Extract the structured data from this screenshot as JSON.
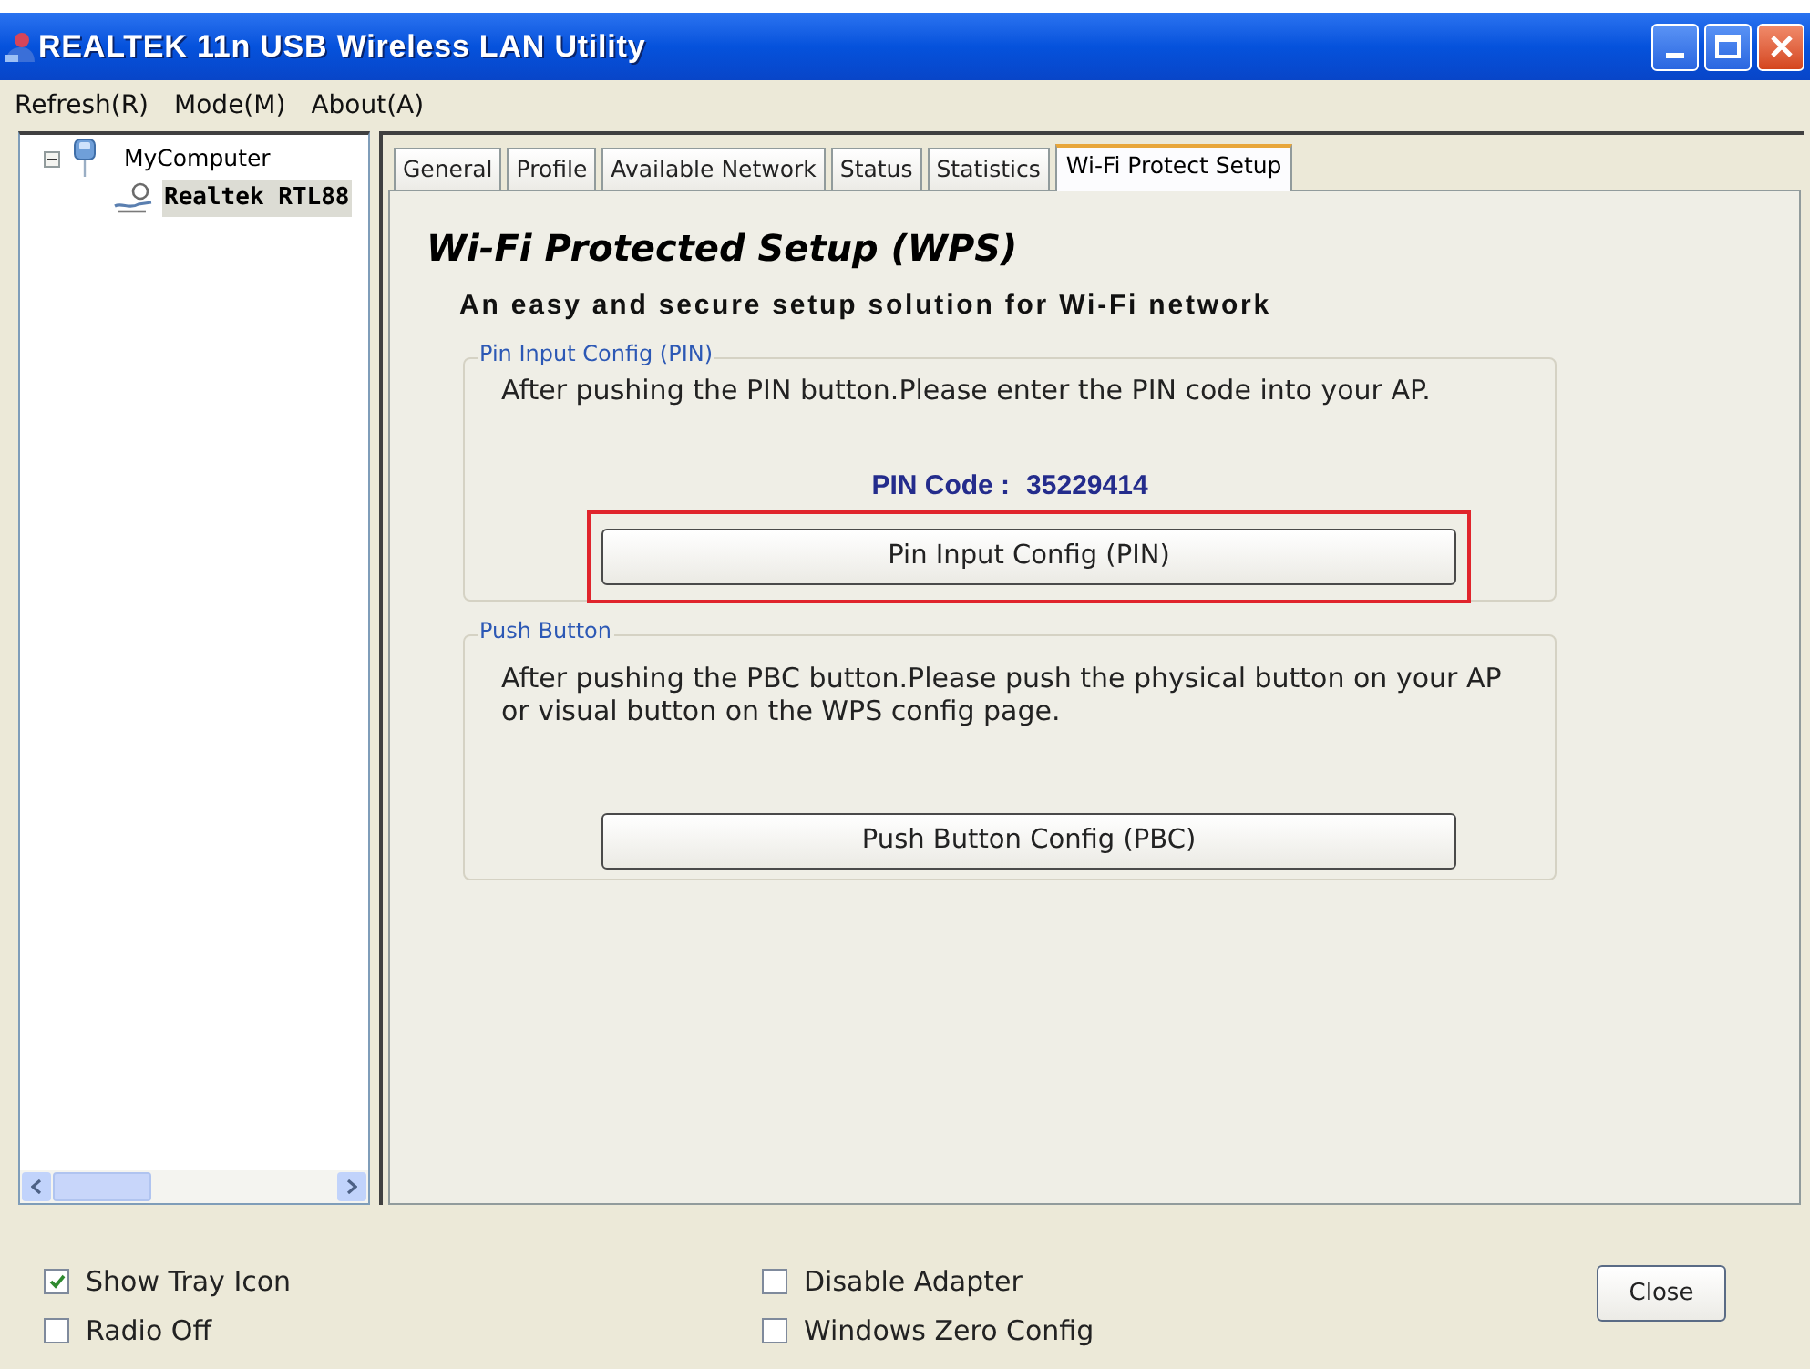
{
  "window": {
    "title": "REALTEK 11n USB Wireless LAN Utility"
  },
  "menu": [
    {
      "label": "Refresh(R)"
    },
    {
      "label": "Mode(M)"
    },
    {
      "label": "About(A)"
    }
  ],
  "tree": [
    {
      "label": "MyComputer",
      "expanded": true,
      "selected": false,
      "children": [
        {
          "label": "Realtek RTL88",
          "selected": true
        }
      ]
    }
  ],
  "tabs": [
    {
      "label": "General",
      "selected": false
    },
    {
      "label": "Profile",
      "selected": false
    },
    {
      "label": "Available Network",
      "selected": false
    },
    {
      "label": "Status",
      "selected": false
    },
    {
      "label": "Statistics",
      "selected": false
    },
    {
      "label": "Wi-Fi Protect Setup",
      "selected": true
    }
  ],
  "panel": {
    "title": "Wi-Fi Protected Setup (WPS)",
    "subtitle": "An easy and secure setup solution for Wi-Fi network",
    "groups": [
      {
        "kind": "pin",
        "legend": "Pin Input Config (PIN)",
        "description": "After pushing the PIN button.Please enter the PIN code into your AP.",
        "pin_label": "PIN Code :",
        "pin_value": "35229414",
        "button": {
          "label": "Pin Input Config (PIN)",
          "highlighted": true
        }
      },
      {
        "kind": "push",
        "legend": "Push Button",
        "description": "After pushing the PBC button.Please push the physical button on your AP\nor visual button on the WPS config page.",
        "button": {
          "label": "Push Button Config (PBC)",
          "highlighted": false
        }
      }
    ]
  },
  "options": [
    {
      "label": "Show Tray Icon",
      "checked": true
    },
    {
      "label": "Radio Off",
      "checked": false
    },
    {
      "label": "Disable Adapter",
      "checked": false
    },
    {
      "label": "Windows Zero Config",
      "checked": false
    }
  ],
  "close_button": {
    "label": "Close"
  }
}
